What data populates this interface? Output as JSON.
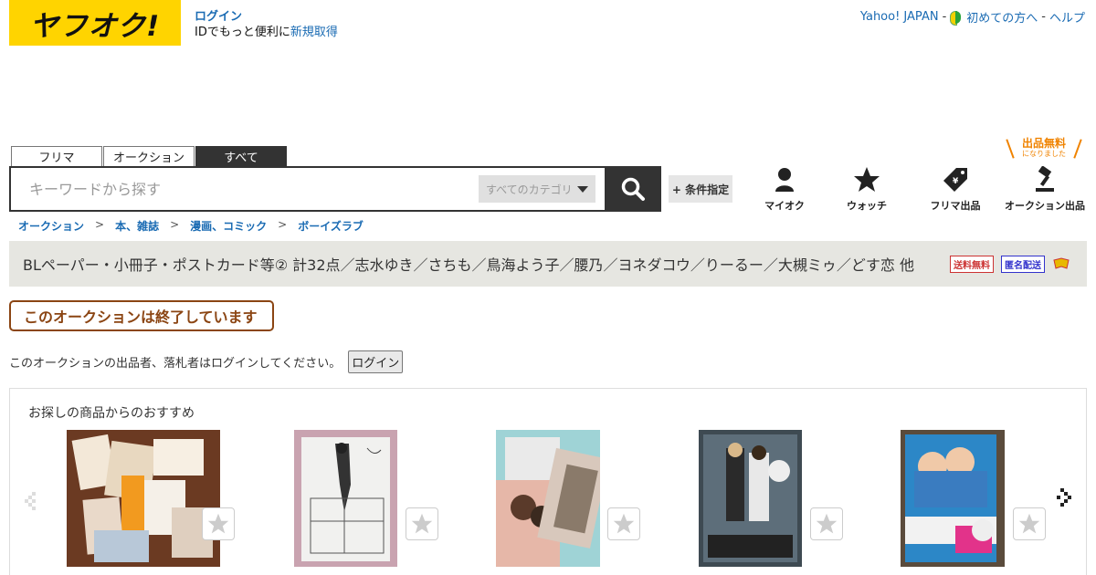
{
  "header": {
    "logo_text": "ヤフオク!",
    "login_link": "ログイン",
    "login_sub_prefix": "IDでもっと便利に",
    "signup_link": "新規取得",
    "top_links": {
      "yahoo_japan": "Yahoo! JAPAN",
      "sep1": "-",
      "first_time": "初めての方へ",
      "sep2": "-",
      "help": "ヘルプ"
    }
  },
  "search": {
    "tabs": [
      "フリマ",
      "オークション",
      "すべて"
    ],
    "active_tab": "すべて",
    "placeholder": "キーワードから探す",
    "category_label": "すべてのカテゴリ",
    "condition_button": "+ 条件指定"
  },
  "nav": {
    "my_auction": "マイオク",
    "watch": "ウォッチ",
    "flea_listing": "フリマ出品",
    "auction_listing": "オークション出品",
    "free_badge_line1": "出品無料",
    "free_badge_line2": "になりました"
  },
  "breadcrumb": [
    "オークション",
    "本、雑誌",
    "漫画、コミック",
    "ボーイズラブ"
  ],
  "breadcrumb_sep": ">",
  "item": {
    "title": "BLペーパー・小冊子・ポストカード等② 計32点／志水ゆき／さちも／鳥海よう子／腰乃／ヨネダコウ／りーるー／大槻ミゥ／どす恋 他",
    "badge_free_shipping": "送料無料",
    "badge_anonymous": "匿名配送"
  },
  "status": {
    "ended_label": "このオークションは終了しています",
    "notice_text": "このオークションの出品者、落札者はログインしてください。",
    "login_button": "ログイン"
  },
  "recommend": {
    "title": "お探しの商品からのおすすめ",
    "items": [
      {
        "image": "bl-papers-pile"
      },
      {
        "image": "manga-sketch-paper"
      },
      {
        "image": "postcard-set"
      },
      {
        "image": "comic-volume-6"
      },
      {
        "image": "comic-volume-2"
      }
    ]
  }
}
